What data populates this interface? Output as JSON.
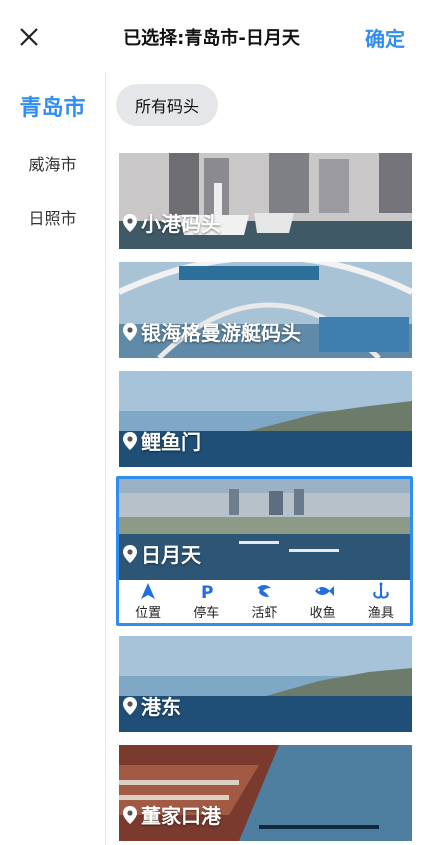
{
  "header": {
    "title": "已选择:青岛市-日月天",
    "confirm_label": "确定"
  },
  "sidebar": {
    "items": [
      {
        "label": "青岛市"
      },
      {
        "label": "威海市"
      },
      {
        "label": "日照市"
      }
    ]
  },
  "filter": {
    "chip_label": "所有码头"
  },
  "docks": [
    {
      "name": "小港码头"
    },
    {
      "name": "银海格曼游艇码头"
    },
    {
      "name": "鲤鱼门"
    },
    {
      "name": "日月天"
    },
    {
      "name": "港东"
    },
    {
      "name": "董家口港"
    }
  ],
  "selected_actions": [
    {
      "label": "位置",
      "icon": "navigation-arrow-icon"
    },
    {
      "label": "停车",
      "icon": "parking-icon"
    },
    {
      "label": "活虾",
      "icon": "shrimp-icon"
    },
    {
      "label": "收鱼",
      "icon": "fish-icon"
    },
    {
      "label": "渔具",
      "icon": "fishing-hook-icon"
    }
  ],
  "colors": {
    "accent": "#2f8ef0",
    "text": "#111111",
    "chip_bg": "#e5e6ea"
  }
}
